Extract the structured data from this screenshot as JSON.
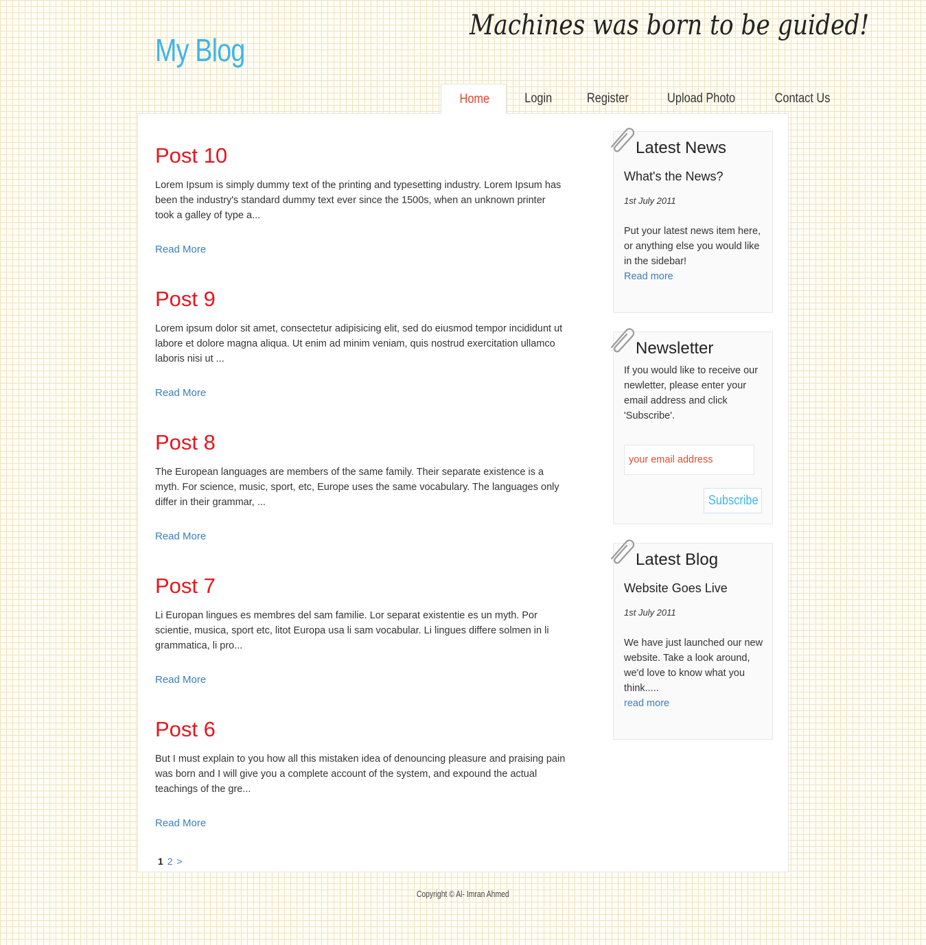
{
  "site": {
    "title": "My Blog",
    "tagline": "Machines was born to be guided!"
  },
  "nav": {
    "items": [
      {
        "label": "Home",
        "active": true
      },
      {
        "label": "Login",
        "active": false
      },
      {
        "label": "Register",
        "active": false
      },
      {
        "label": "Upload Photo",
        "active": false
      },
      {
        "label": "Contact Us",
        "active": false
      }
    ]
  },
  "posts": [
    {
      "title": "Post 10",
      "excerpt": "Lorem Ipsum is simply dummy text of the printing and typesetting industry. Lorem Ipsum has been the industry's standard dummy text ever since the 1500s, when an unknown printer took a galley of type a...",
      "read_more": "Read More"
    },
    {
      "title": "Post 9",
      "excerpt": "Lorem ipsum dolor sit amet, consectetur adipisicing elit, sed do eiusmod tempor incididunt ut labore et dolore magna aliqua. Ut enim ad minim veniam, quis nostrud exercitation ullamco laboris nisi ut ...",
      "read_more": "Read More"
    },
    {
      "title": "Post 8",
      "excerpt": "The European languages are members of the same family. Their separate existence is a myth. For science, music, sport, etc, Europe uses the same vocabulary. The languages only differ in their grammar, ...",
      "read_more": "Read More"
    },
    {
      "title": "Post 7",
      "excerpt": "Li Europan lingues es membres del sam familie. Lor separat existentie es un myth. Por scientie, musica, sport etc, litot Europa usa li sam vocabular. Li lingues differe solmen in li grammatica, li pro...",
      "read_more": "Read More"
    },
    {
      "title": "Post 6",
      "excerpt": "But I must explain to you how all this mistaken idea of denouncing pleasure and praising pain was born and I will give you a complete account of the system, and expound the actual teachings of the gre...",
      "read_more": "Read More"
    }
  ],
  "pagination": {
    "current": "1",
    "next_page": "2",
    "next_arrow": ">"
  },
  "sidebar": {
    "latest_news": {
      "title": "Latest News",
      "heading": "What's the News?",
      "date": "1st July 2011",
      "text": "Put your latest news item here, or anything else you would like in the sidebar!",
      "link": "Read more"
    },
    "newsletter": {
      "title": "Newsletter",
      "text": "If you would like to receive our newletter, please enter your email address and click 'Subscribe'.",
      "email_placeholder": "your email address",
      "email_value": "",
      "button": "Subscribe"
    },
    "latest_blog": {
      "title": "Latest Blog",
      "heading": "Website Goes Live",
      "date": "1st July 2011",
      "text": "We have just launched our new website. Take a look around, we'd love to know what you think.....",
      "link": "read more"
    }
  },
  "footer": {
    "copyright": "Copyright © Al- Imran Ahmed"
  },
  "colors": {
    "brand": "#3fb5e8",
    "post_title": "#e8151c",
    "link": "#3b7dc0",
    "nav_active": "#e4452c"
  },
  "icons": {
    "widget_clip": "paperclip-icon"
  }
}
